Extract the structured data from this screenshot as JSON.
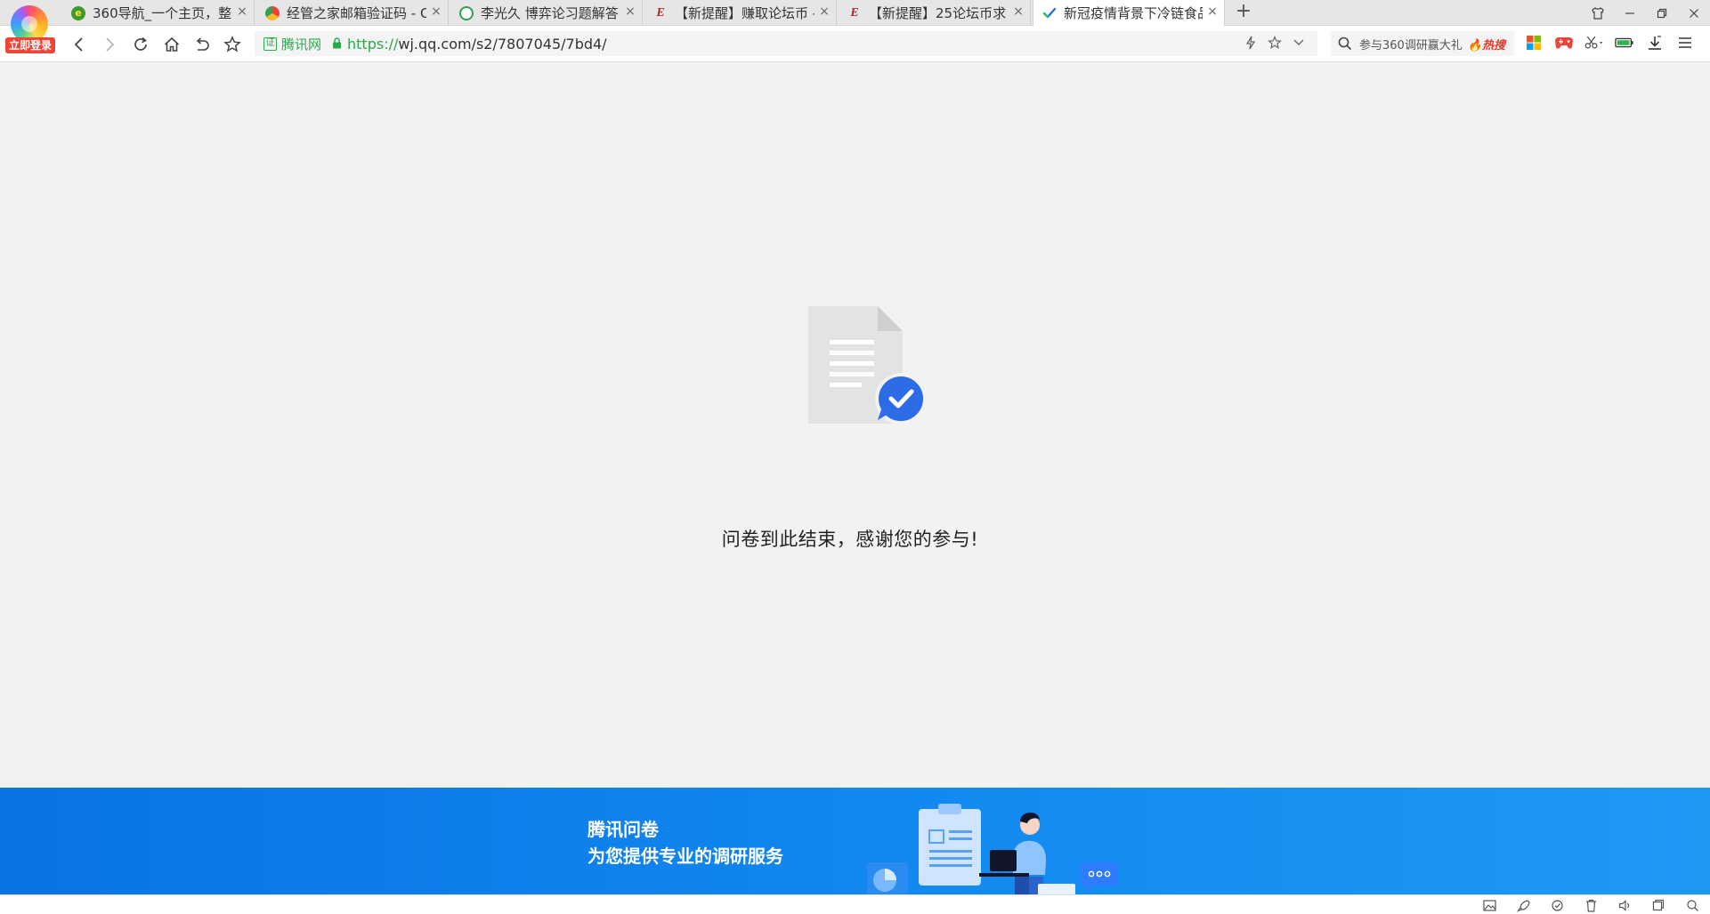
{
  "browser": {
    "login_badge": "立即登录",
    "tabs": [
      {
        "title": "360导航_一个主页，整",
        "favicon": "360-nav-icon",
        "active": false
      },
      {
        "title": "经管之家邮箱验证码 - C",
        "favicon": "chrome-icon",
        "active": false
      },
      {
        "title": "李光久 博弈论习题解答",
        "favicon": "search-result-icon",
        "active": false
      },
      {
        "title": "【新提醒】赚取论坛币 -",
        "favicon": "pinggu-forum-icon",
        "active": false
      },
      {
        "title": "【新提醒】25论坛币求",
        "favicon": "pinggu-forum-icon",
        "active": false
      },
      {
        "title": "新冠疫情背景下冷链食品",
        "favicon": "wj-check-icon",
        "active": true
      }
    ],
    "close_glyph": "×",
    "new_tab_glyph": "+"
  },
  "addressbar": {
    "cert_label": "腾讯网",
    "url_scheme": "https://",
    "url_rest": "wj.qq.com/s2/7807045/7bd4/"
  },
  "search": {
    "placeholder_text": "参与360调研赢大礼",
    "hot_label": "热搜"
  },
  "content": {
    "message": "问卷到此结束，感谢您的参与!"
  },
  "footer": {
    "brand_name": "腾讯问卷",
    "tagline": "为您提供专业的调研服务"
  },
  "colors": {
    "page_bg": "#f2f2f2",
    "banner_blue": "#0a73e6",
    "check_blue": "#2e6be6",
    "secure_green": "#2aa84a",
    "hot_red": "#e73a2c"
  }
}
